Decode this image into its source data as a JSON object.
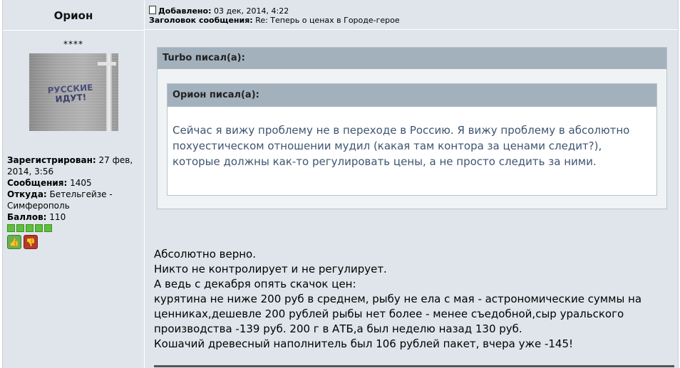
{
  "author": {
    "name": "Орион",
    "rank": "****",
    "avatar_text": [
      "РУССКИЕ",
      "ИДУТ!"
    ],
    "fields": [
      {
        "label": "Зарегистрирован:",
        "value": "27 фев, 2014, 3:56"
      },
      {
        "label": "Сообщения:",
        "value": "1405"
      },
      {
        "label": "Откуда:",
        "value": "Бетельгейзе - Симферополь"
      },
      {
        "label": "Баллов:",
        "value": "110"
      }
    ],
    "rating_level": 5
  },
  "message": {
    "added_label": "Добавлено:",
    "added_value": "03 дек, 2014, 4:22",
    "subject_label": "Заголовок сообщения:",
    "subject_value": "Re: Теперь о ценах в Городе-герое",
    "outer_quote_author": "Turbo писал(а):",
    "inner_quote_author": "Орион писал(а):",
    "inner_quote_text": "Сейчас я вижу проблему не в переходе в Россию. Я вижу проблему в абсолютно похуестическом отношении мудил (какая там контора за ценами следит?), которые должны как-то регулировать цены, а не просто следить за ними.",
    "body_lines": [
      "Абсолютно верно.",
      "Никто не контролирует и не регулирует.",
      "А ведь с декабря опять скачок цен:",
      "курятина не ниже 200 руб в среднем, рыбу не ела с мая - астрономические суммы на ценниках,дешевле 200 рублей рыбы нет более - менее съедобной,сыр уральского производства -139 руб. 200 г в АТБ,а был неделю назад 130 руб.",
      "Кошачий древесный наполнитель был 106 рублей пакет, вчера уже -145!"
    ]
  },
  "colors": {
    "panel": "#dfe5ea",
    "quote_header": "#a3b1bd",
    "quote_text": "#3e5570"
  }
}
